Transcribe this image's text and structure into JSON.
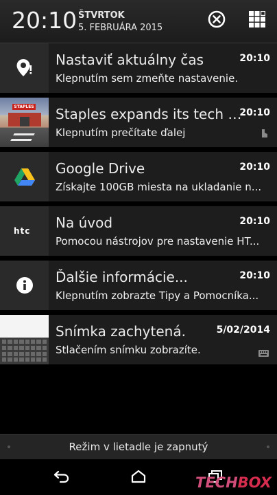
{
  "header": {
    "time": "20:10",
    "day": "ŠTVRTOK",
    "date": "5. FEBRUÁRA 2015"
  },
  "notifications": [
    {
      "icon": "location-alert-icon",
      "title": "Nastaviť aktuálny čas",
      "time": "20:10",
      "text": "Klepnutím sem zmeňte nastavenie."
    },
    {
      "icon": "staples-store-thumbnail",
      "title": "Staples expands its tech s...",
      "time": "20:10",
      "text": "Klepnutím prečítate ďalej",
      "sub_icon": "blinkfeed-icon"
    },
    {
      "icon": "google-drive-icon",
      "title": "Google Drive",
      "time": "20:10",
      "text": "Získajte 100GB miesta na ukladanie n..."
    },
    {
      "icon": "htc-logo-icon",
      "title": "Na úvod",
      "time": "20:10",
      "text": "Pomocou nástrojov pre nastavenie HT..."
    },
    {
      "icon": "info-icon",
      "title": "Ďalšie informácie...",
      "time": "20:10",
      "text": "Klepnutím zobrazte Tipy a Pomocníka..."
    },
    {
      "icon": "screenshot-thumbnail",
      "title": "Snímka zachytená.",
      "time": "5/02/2014",
      "text": "Stlačením snímku zobrazíte.",
      "sub_icon": "keyboard-icon"
    }
  ],
  "airplane_bar": {
    "text": "Režim v lietadle je zapnutý"
  },
  "navbar": {
    "buttons": [
      "back-icon",
      "home-icon",
      "recent-apps-icon"
    ]
  },
  "watermark": {
    "part1": "TECH",
    "part2": "BOX"
  },
  "colors": {
    "header_bg": "#242424",
    "notif_bg": "#1d1d1d",
    "icon_bg": "#2a2a2a",
    "watermark_pink": "#d14d7a",
    "watermark_red": "#d62d4f"
  }
}
